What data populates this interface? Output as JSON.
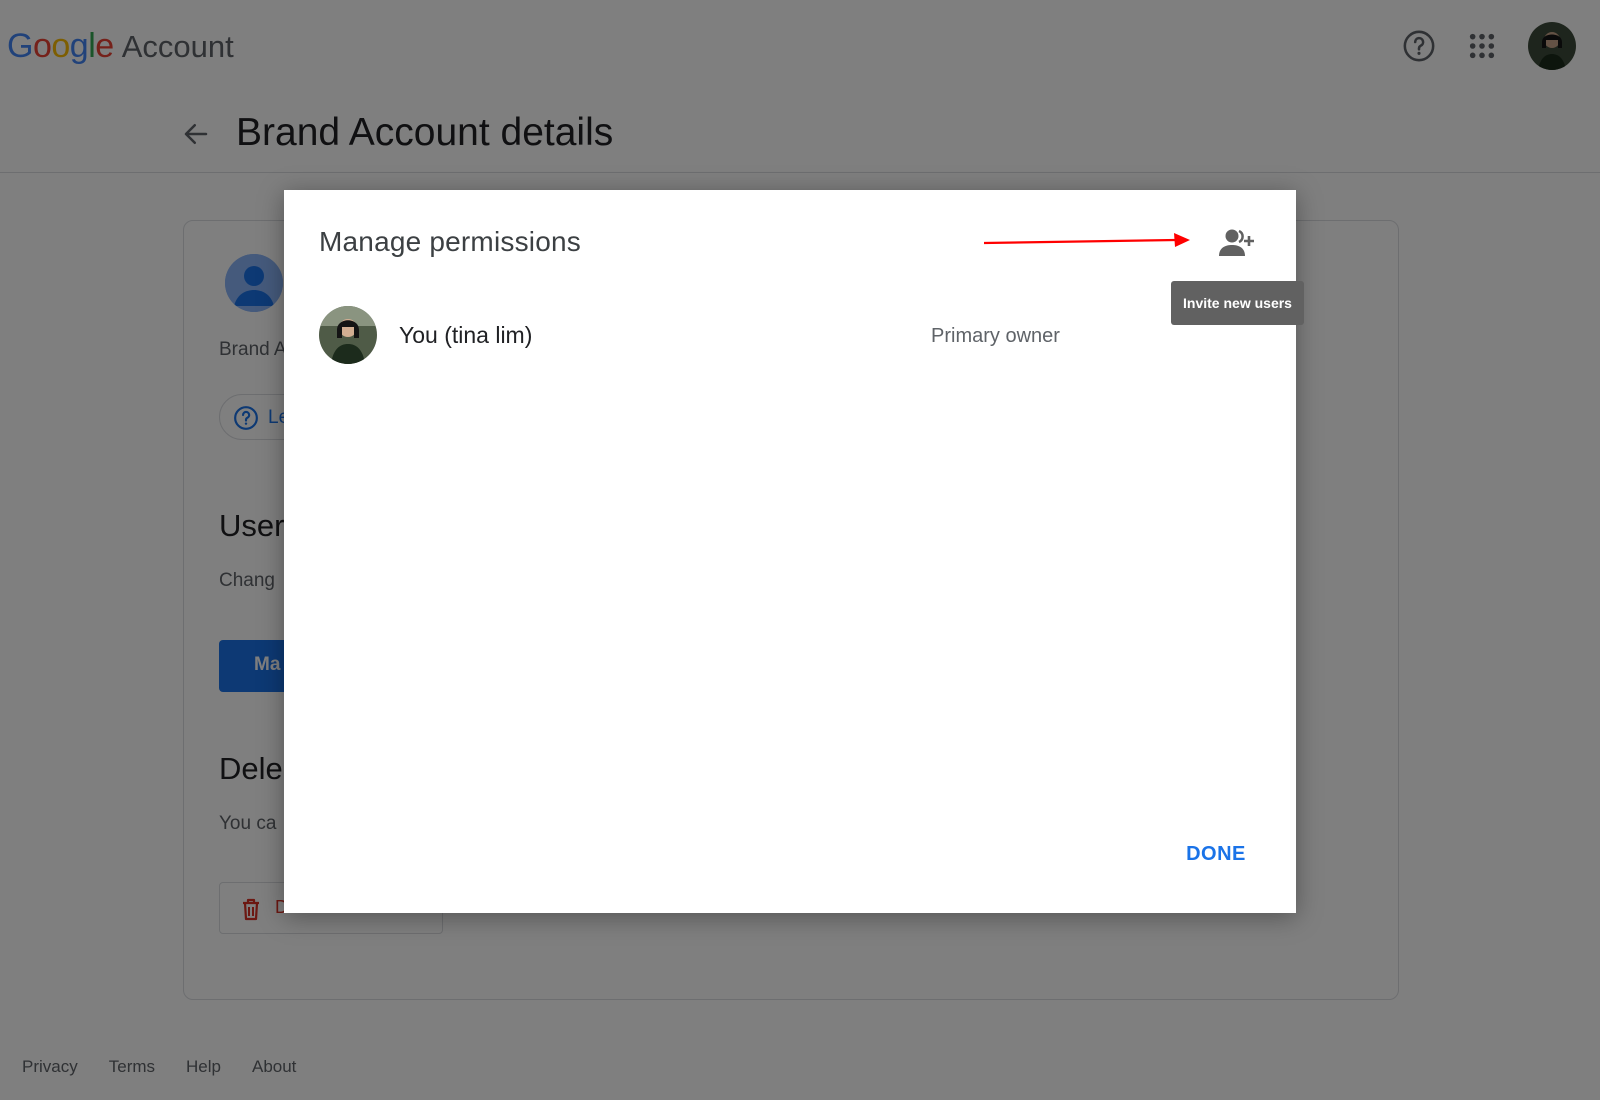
{
  "header": {
    "logo_letters": [
      {
        "char": "G",
        "color": "#4285F4"
      },
      {
        "char": "o",
        "color": "#EA4335"
      },
      {
        "char": "o",
        "color": "#FBBC05"
      },
      {
        "char": "g",
        "color": "#4285F4"
      },
      {
        "char": "l",
        "color": "#34A853"
      },
      {
        "char": "e",
        "color": "#EA4335"
      }
    ],
    "product_name": "Account",
    "icons": [
      "help-circle-icon",
      "apps-grid-icon",
      "profile-avatar"
    ]
  },
  "page": {
    "title": "Brand Account details",
    "back_icon": "arrow-left-icon"
  },
  "card": {
    "brand_label": "Brand A",
    "learn_more_label": "Le",
    "users_heading": "User",
    "users_description": "Chang",
    "manage_button_label": "Ma",
    "delete_heading": "Dele",
    "delete_description": "You ca",
    "delete_button_label": "D"
  },
  "footer": {
    "links": [
      "Privacy",
      "Terms",
      "Help",
      "About"
    ]
  },
  "dialog": {
    "title": "Manage permissions",
    "invite_icon": "person-add-icon",
    "invite_tooltip": "Invite new users",
    "users": [
      {
        "name": "You (tina lim)",
        "role": "Primary owner"
      }
    ],
    "done_label": "DONE"
  },
  "colors": {
    "accent": "#1a73e8",
    "scrim": "rgba(0,0,0,0.5)",
    "annotation_arrow": "#ff0000",
    "danger": "#d93025"
  }
}
